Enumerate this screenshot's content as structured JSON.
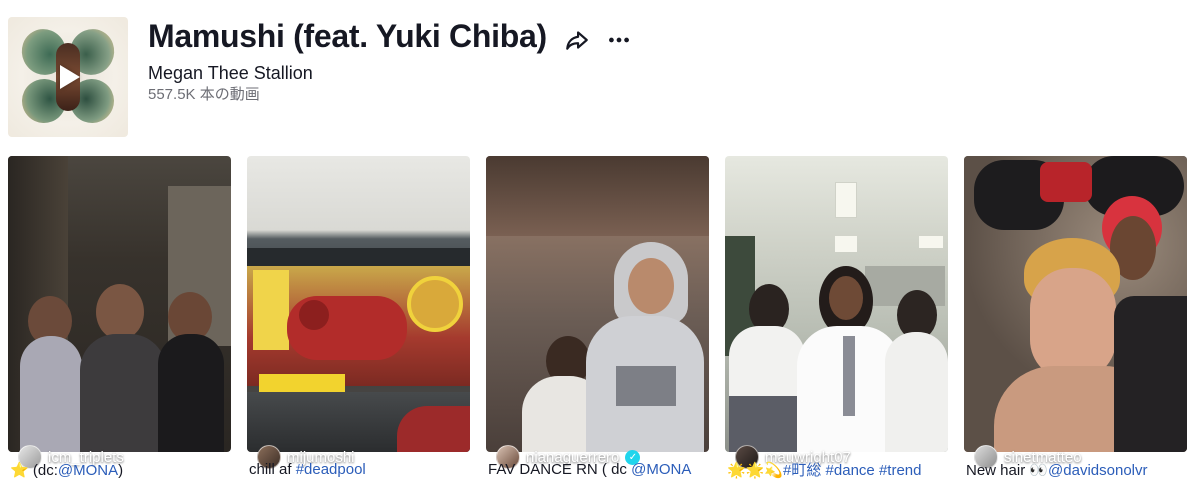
{
  "header": {
    "title": "Mamushi (feat. Yuki Chiba)",
    "artist": "Megan Thee Stallion",
    "video_count": "557.5K 本の動画",
    "share_icon": "share-icon",
    "more_icon": "more-icon"
  },
  "videos": [
    {
      "author": "icm_triplets",
      "verified": false,
      "caption": {
        "prefix_emoji": "⭐",
        "text": " (dc:",
        "tag": "@MONA",
        "suffix": ")"
      }
    },
    {
      "author": "mijumoshi",
      "verified": false,
      "caption": {
        "text": "chill af ",
        "tag": "#deadpool"
      }
    },
    {
      "author": "nianaguerrero",
      "verified": true,
      "caption": {
        "text": "FAV DANCE RN ( dc ",
        "tag": "@MONA"
      }
    },
    {
      "author": "mauwright07",
      "verified": false,
      "caption": {
        "prefix_emoji": "🌟🌟💫",
        "tag1": "#町総",
        "tag2": "#dance",
        "tag3": "#trend"
      }
    },
    {
      "author": "sinetmatteo",
      "verified": false,
      "caption": {
        "text": "New hair ",
        "emoji": "👀",
        "tag": "@davidsonolvr"
      }
    }
  ],
  "colors": {
    "text_primary": "#161823",
    "text_secondary": "#6d6e75",
    "link": "#2b5db9",
    "verified": "#20d5ec"
  }
}
